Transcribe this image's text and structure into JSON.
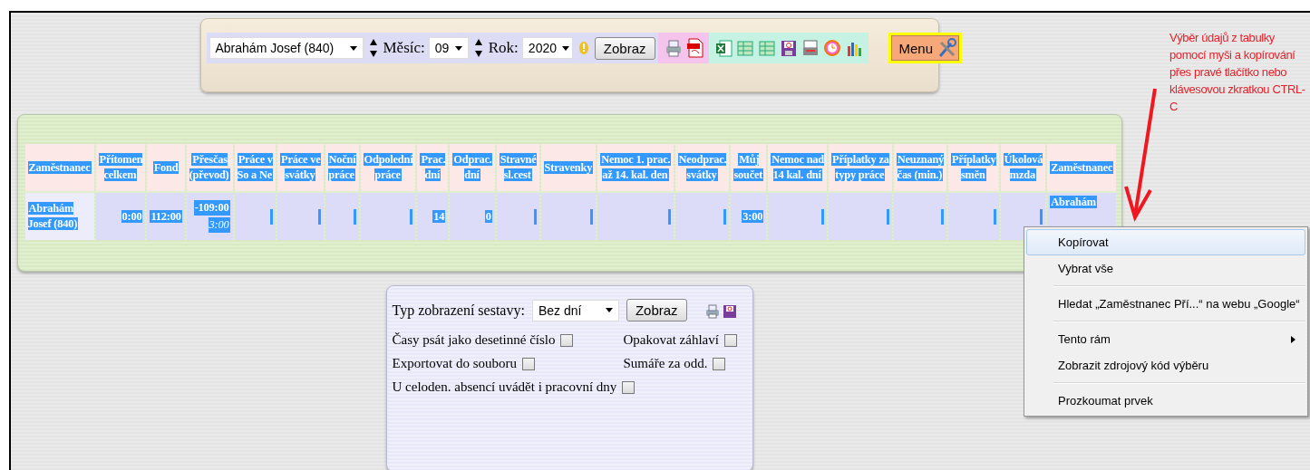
{
  "toolbar": {
    "employee_select": "Abrahám Josef (840)",
    "month_label": "Měsíc:",
    "month_select": "09",
    "year_label": "Rok:",
    "year_select": "2020",
    "show_button": "Zobraz",
    "menu_button": "Menu"
  },
  "table": {
    "text_selected": true,
    "columns": [
      "Zaměstnanec",
      "Přítomen\ncelkem",
      "Fond",
      "Přesčas\n(převod)",
      "Práce v\nSo a Ne",
      "Práce ve\nsvátky",
      "Noční\npráce",
      "Odpolední\npráce",
      "Prac.\ndní",
      "Odprac.\ndní",
      "Stravné\nsl.cest",
      "Stravenky",
      "Nemoc 1. prac.\naž 14. kal. den",
      "Neodprac.\nsvátky",
      "Můj\nsoučet",
      "Nemoc nad\n14 kal. dní",
      "Příplatky za\ntypy práce",
      "Neuznaný\nčas (min.)",
      "Příplatky\nsměn",
      "Úkolová\nmzda",
      "Zaměstnanec"
    ],
    "rows": [
      {
        "cells": [
          {
            "text": "Abrahám\nJosef (840)"
          },
          {
            "text": "0:00"
          },
          {
            "text": "112:00"
          },
          {
            "text": "-109:00",
            "transfer": "3:00"
          },
          null,
          null,
          null,
          null,
          {
            "text": "14"
          },
          {
            "text": "0"
          },
          null,
          null,
          null,
          null,
          {
            "text": "3:00"
          },
          null,
          null,
          null,
          null,
          null,
          {
            "text": "Abrahám"
          }
        ]
      }
    ]
  },
  "options": {
    "report_type_label": "Typ zobrazení sestavy:",
    "report_type_select": "Bez dní",
    "show_button": "Zobraz",
    "checkboxes": [
      {
        "label": "Časy psát jako desetinné číslo",
        "checked": false
      },
      {
        "label": "Opakovat záhlaví",
        "checked": false
      },
      {
        "label": "Exportovat do souboru",
        "checked": false
      },
      {
        "label": "Sumáře za odd.",
        "checked": false
      },
      {
        "label": "U celoden. absencí uvádět i pracovní dny",
        "checked": false
      }
    ]
  },
  "context_menu": {
    "items": [
      {
        "label": "Kopírovat",
        "selected": true,
        "submenu": false
      },
      {
        "label": "Vybrat vše",
        "selected": false,
        "submenu": false
      },
      {
        "kind": "separator"
      },
      {
        "label": "Hledat „Zaměstnanec Pří...“ na webu „Google“",
        "selected": false,
        "submenu": false
      },
      {
        "kind": "separator"
      },
      {
        "label": "Tento rám",
        "selected": false,
        "submenu": true
      },
      {
        "label": "Zobrazit zdrojový kód výběru",
        "selected": false,
        "submenu": false
      },
      {
        "kind": "separator"
      },
      {
        "label": "Prozkoumat prvek",
        "selected": false,
        "submenu": false
      }
    ]
  },
  "annotation": {
    "text": "Výběr údajů z tabulky pomocí myši a kopírování přes pravé tlačítko nebo klávesovou zkratkou CTRL-C"
  }
}
